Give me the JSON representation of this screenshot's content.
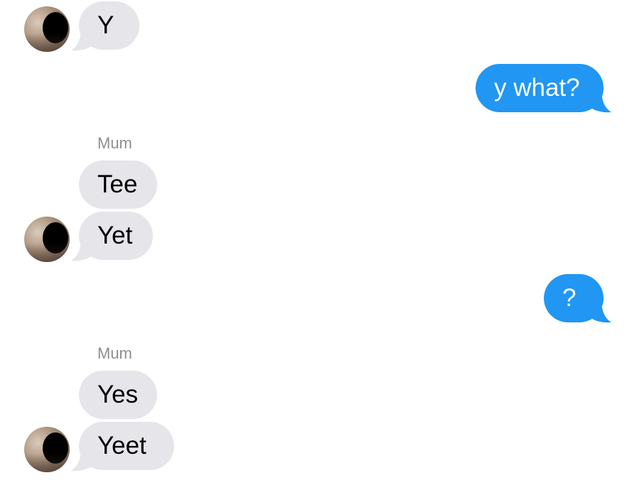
{
  "conversation": {
    "messages": [
      {
        "from": "incoming",
        "text": "Y"
      },
      {
        "from": "outgoing",
        "text": "y what?"
      },
      {
        "from": "incoming",
        "sender": "Mum",
        "text": "Tee"
      },
      {
        "from": "incoming",
        "text": "Yet"
      },
      {
        "from": "outgoing",
        "text": "?"
      },
      {
        "from": "incoming",
        "sender": "Mum",
        "text": "Yes"
      },
      {
        "from": "incoming",
        "text": "Yeet"
      }
    ]
  },
  "colors": {
    "incoming_bubble": "#e5e5ea",
    "outgoing_bubble": "#2196f3",
    "sender_label": "#8e8e93"
  }
}
